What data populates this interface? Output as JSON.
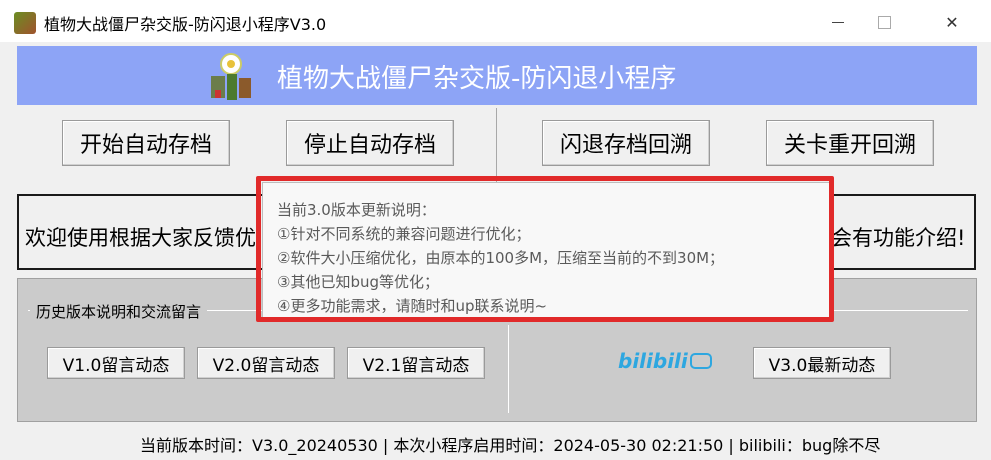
{
  "window": {
    "title": "植物大战僵尸杂交版-防闪退小程序V3.0",
    "icon": "plant-zombie-icon",
    "minimize_glyph": "",
    "maximize_glyph": "",
    "close_glyph": "✕"
  },
  "banner": {
    "title": "植物大战僵尸杂交版-防闪退小程序"
  },
  "buttons": {
    "start_autosave": "开始自动存档",
    "stop_autosave": "停止自动存档",
    "crash_rollback": "闪退存档回溯",
    "level_restart_rollback": "关卡重开回溯"
  },
  "welcome": {
    "text_start": "欢迎使用根据大家反馈优",
    "text_end": "会有功能介绍!"
  },
  "history": {
    "group_title": "历史版本说明和交流留言",
    "v1": "V1.0留言动态",
    "v2": "V2.0留言动态",
    "v21": "V2.1留言动态",
    "v3": "V3.0最新动态",
    "bilibili_logo": "bilibili"
  },
  "status": {
    "text": "当前版本时间：V3.0_20240530 | 本次小程序启用时间：2024-05-30 02:21:50 | bilibili：bug除不尽"
  },
  "tooltip": {
    "lines": [
      "当前3.0版本更新说明：",
      "①针对不同系统的兼容问题进行优化；",
      "②软件大小压缩优化，由原本的100多M，压缩至当前的不到30M；",
      "③其他已知bug等优化；",
      "④更多功能需求，请随时和up联系说明~"
    ]
  },
  "colors": {
    "banner_bg": "#8da4f6",
    "highlight": "#e12a2a",
    "bilibili": "#2ea7e0"
  }
}
